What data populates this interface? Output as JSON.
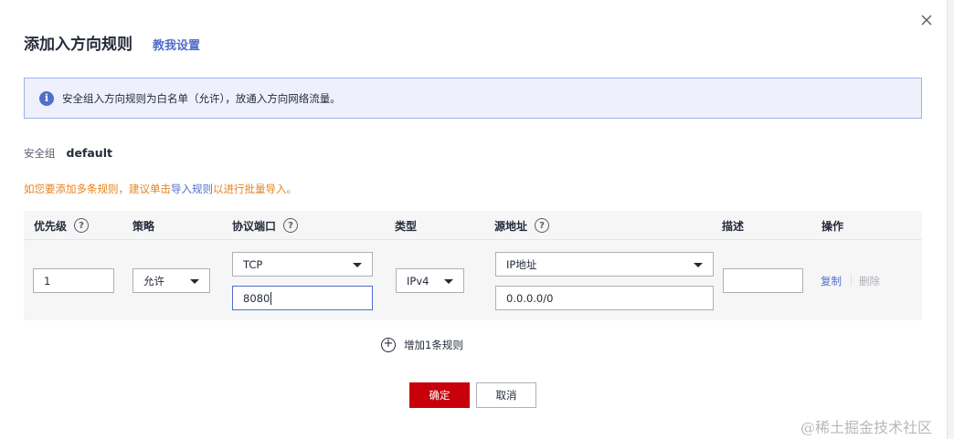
{
  "dialog": {
    "title": "添加入方向规则",
    "teach_link": "教我设置",
    "close_glyph": "✕"
  },
  "info": {
    "icon_glyph": "i",
    "text": "安全组入方向规则为白名单（允许），放通入方向网络流量。"
  },
  "security_group": {
    "label": "安全组",
    "value": "default"
  },
  "hint": {
    "before": "如您要添加多条规则，建议单击",
    "link": "导入规则",
    "after": "以进行批量导入。"
  },
  "table": {
    "headers": {
      "priority": "优先级",
      "policy": "策略",
      "protocol_port": "协议端口",
      "type": "类型",
      "source": "源地址",
      "description": "描述",
      "actions": "操作"
    },
    "help_glyph": "?",
    "row": {
      "priority": "1",
      "policy": "允许",
      "protocol": "TCP",
      "port": "8080",
      "type": "IPv4",
      "source_type": "IP地址",
      "source_value": "0.0.0.0/0",
      "description": "",
      "copy": "复制",
      "delete": "删除"
    }
  },
  "add_rule": {
    "icon_glyph": "+",
    "label": "增加1条规则"
  },
  "buttons": {
    "ok": "确定",
    "cancel": "取消"
  },
  "watermark": "@稀土掘金技术社区",
  "colors": {
    "primary": "#526ecc",
    "danger_button": "#c7000b",
    "warning_text": "#e6831f",
    "info_bg": "#eef1fb"
  }
}
